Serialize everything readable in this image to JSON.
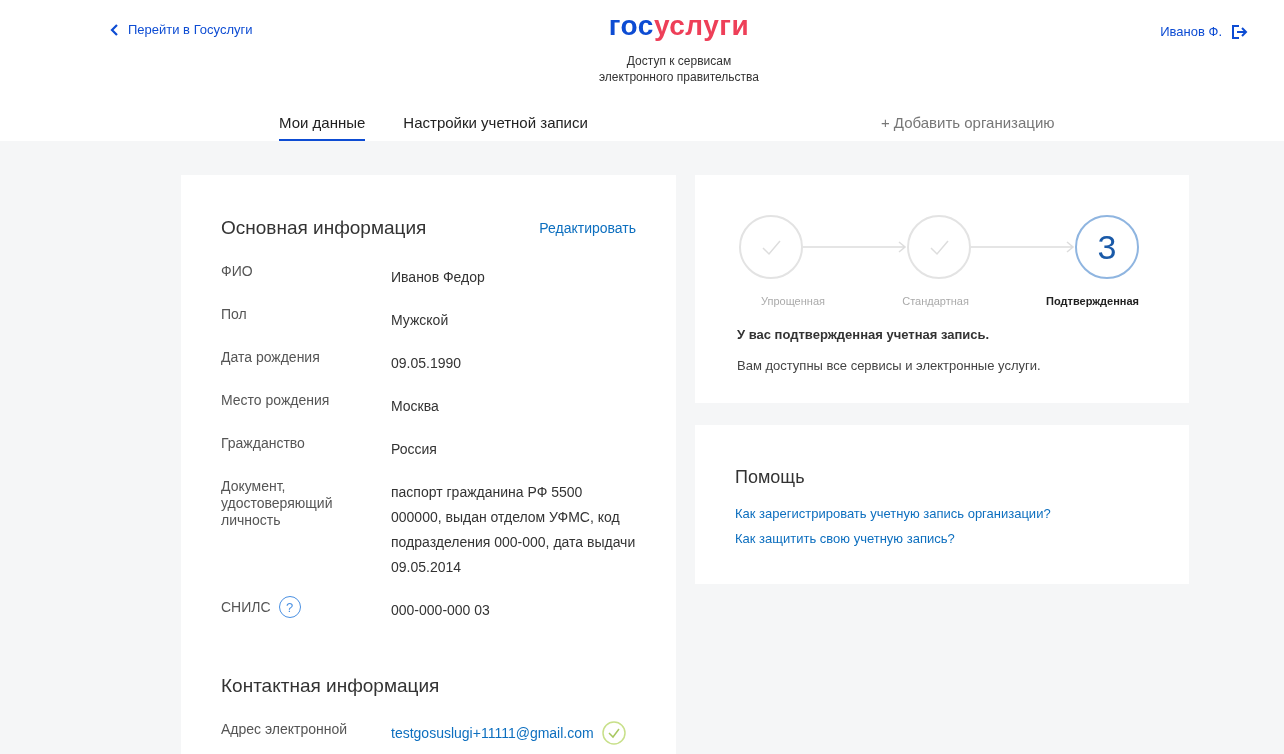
{
  "header": {
    "back_link": "Перейти в Госуслуги",
    "logo": {
      "part_1": "гос",
      "part_2": "услуги"
    },
    "subtitle_line_1": "Доступ к сервисам",
    "subtitle_line_2": "электронного правительства",
    "user": "Иванов Ф."
  },
  "tabs": [
    {
      "label": "Мои данные",
      "selected": true
    },
    {
      "label": "Настройки учетной записи",
      "selected": false
    }
  ],
  "add_organization": "+ Добавить организацию",
  "main_info": {
    "title": "Основная информация",
    "edit_link": "Редактировать",
    "rows": [
      {
        "label": "ФИО",
        "value": "Иванов Федор"
      },
      {
        "label": "Пол",
        "value": "Мужской"
      },
      {
        "label": "Дата рождения",
        "value": "09.05.1990"
      },
      {
        "label": "Место рождения",
        "value": "Москва"
      },
      {
        "label": "Гражданство",
        "value": "Россия"
      },
      {
        "label": "Документ, удостоверяющий личность",
        "value": "паспорт гражданина РФ 5500 000000, выдан отделом УФМС, код подразделения 000-000, дата выдачи 09.05.2014"
      },
      {
        "label": "СНИЛС",
        "value": "000-000-000 03",
        "help_icon": "?"
      }
    ]
  },
  "contact_info": {
    "title": "Контактная информация",
    "rows": [
      {
        "label": "Адрес электронной",
        "value": "testgosuslugi+11111@gmail.com",
        "verified": true
      }
    ]
  },
  "account_level": {
    "steps": [
      {
        "label": "Упрощенная",
        "done": true,
        "selected": false
      },
      {
        "label": "Стандартная",
        "done": true,
        "selected": false
      },
      {
        "label": "Подтвержденная",
        "number": "3",
        "done": false,
        "selected": true
      }
    ],
    "heading": "У вас подтвержденная учетная запись.",
    "text": "Вам доступны все сервисы и электронные услуги."
  },
  "help": {
    "title": "Помощь",
    "links": [
      "Как зарегистрировать учетную запись организации?",
      "Как защитить свою учетную запись?"
    ]
  }
}
